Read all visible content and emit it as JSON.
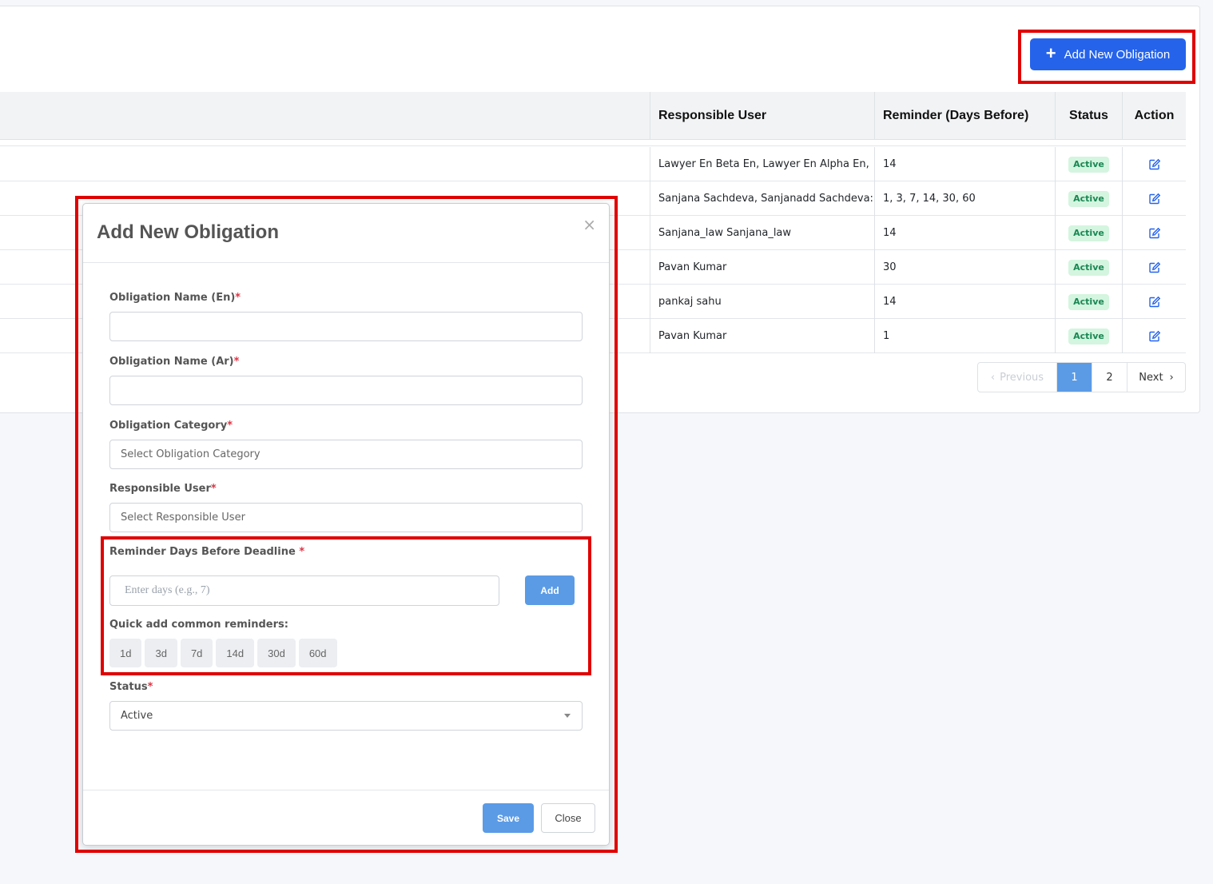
{
  "header": {
    "add_button_label": "Add New Obligation"
  },
  "table": {
    "columns": [
      "Responsible User",
      "Reminder (Days Before)",
      "Status",
      "Action"
    ],
    "rows": [
      {
        "user": "Lawyer En Beta En, Lawyer En Alpha En,",
        "days": "14",
        "status": "Active"
      },
      {
        "user": "Sanjana Sachdeva, Sanjanadd Sachdeva:",
        "days": "1, 3, 7, 14, 30, 60",
        "status": "Active"
      },
      {
        "user": "Sanjana_law Sanjana_law",
        "days": "14",
        "status": "Active"
      },
      {
        "user": "Pavan Kumar",
        "days": "30",
        "status": "Active"
      },
      {
        "user": "pankaj sahu",
        "days": "14",
        "status": "Active"
      },
      {
        "user": "Pavan Kumar",
        "days": "1",
        "status": "Active"
      }
    ]
  },
  "pagination": {
    "previous": "Previous",
    "pages": [
      "1",
      "2"
    ],
    "next": "Next"
  },
  "modal": {
    "title": "Add New Obligation",
    "close_symbol": "×",
    "required_mark": "*",
    "name_en_label": "Obligation Name (En)",
    "name_ar_label": "Obligation Name (Ar)",
    "category_label": "Obligation Category",
    "category_placeholder": "Select Obligation Category",
    "user_label": "Responsible User",
    "user_placeholder": "Select Responsible User",
    "reminder_label": "Reminder Days Before Deadline",
    "reminder_placeholder": "Enter days (e.g., 7)",
    "add_label": "Add",
    "quick_label": "Quick add common reminders:",
    "quick_options": [
      "1d",
      "3d",
      "7d",
      "14d",
      "30d",
      "60d"
    ],
    "status_label": "Status",
    "status_value": "Active",
    "save_label": "Save",
    "close_label": "Close"
  },
  "colors": {
    "primary": "#2563eb",
    "button_light": "#5b9be6",
    "highlight": "#e00000",
    "active_badge_bg": "#d4f5df",
    "active_badge_text": "#198754"
  }
}
